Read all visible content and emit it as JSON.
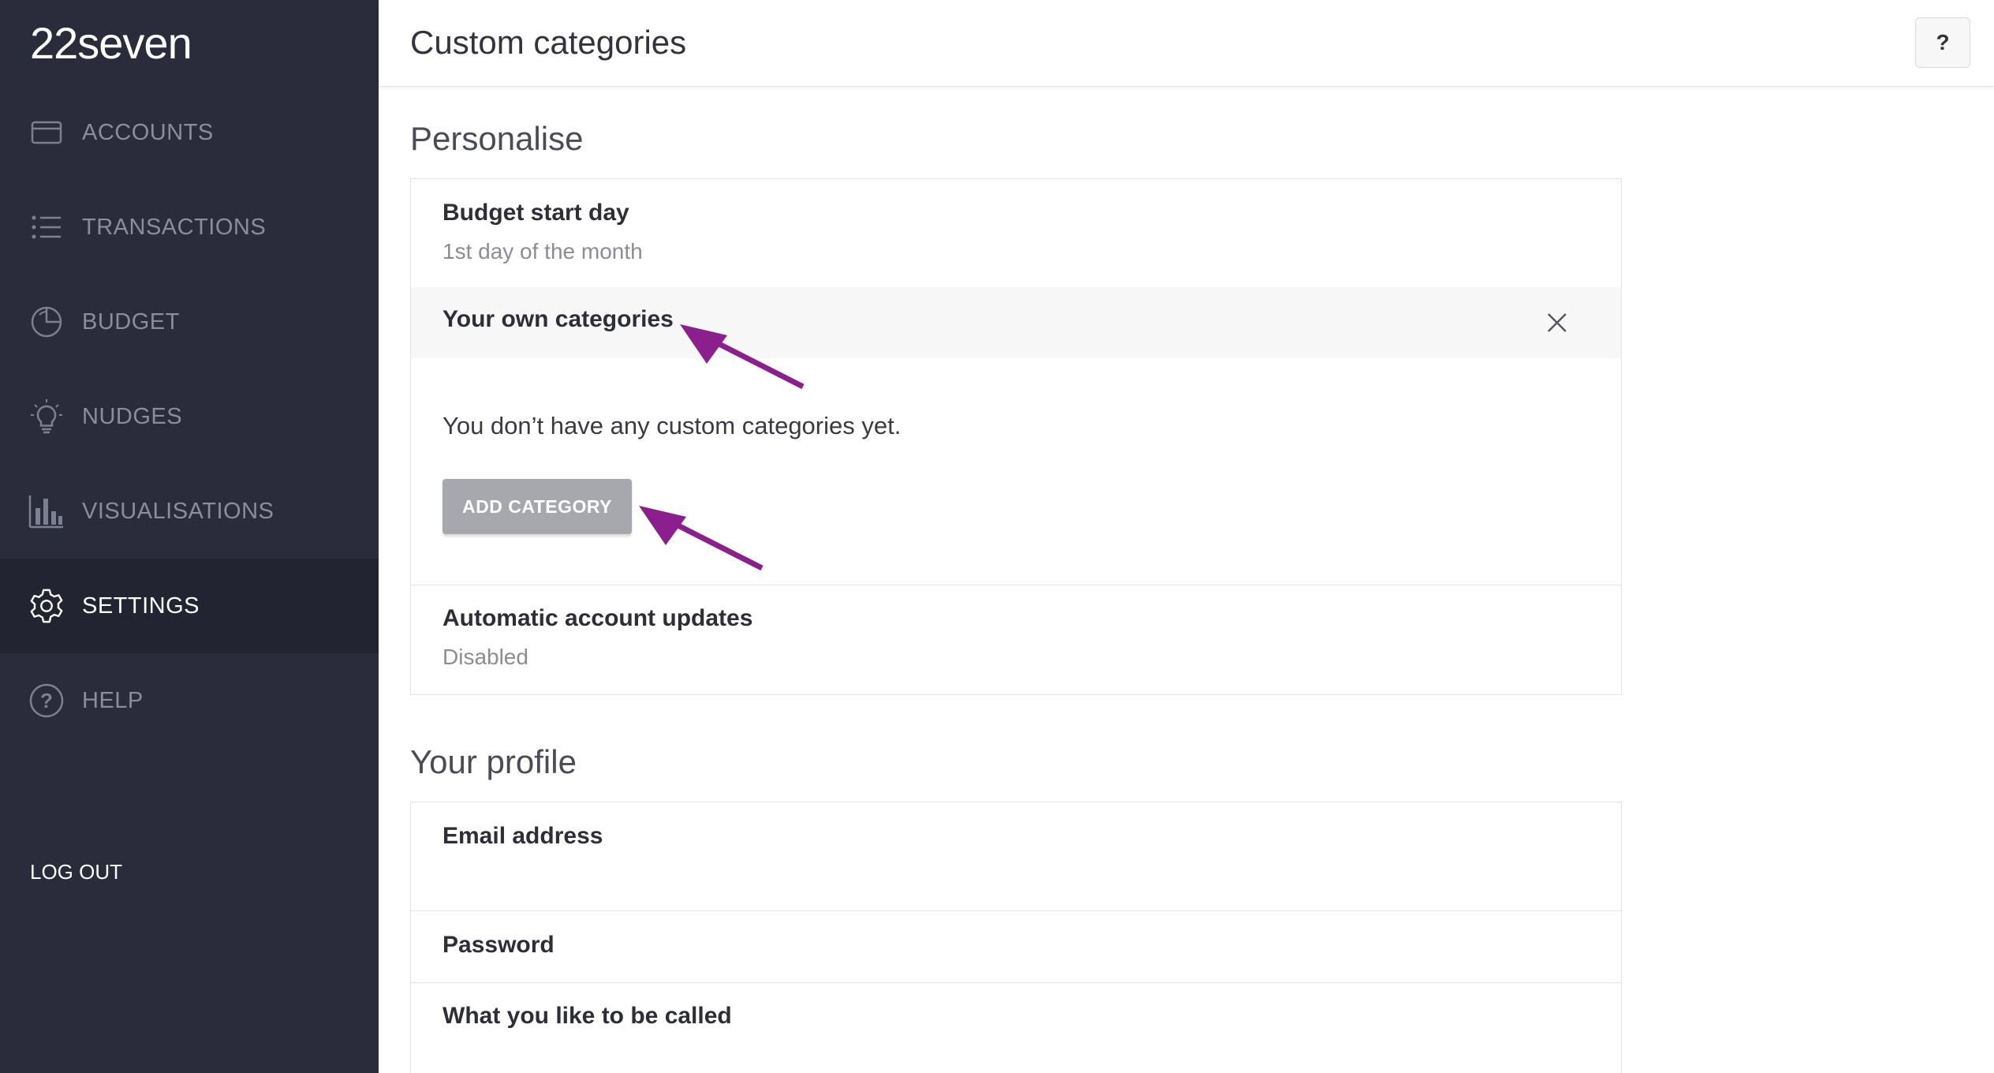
{
  "app": {
    "logo": "22seven"
  },
  "sidebar": {
    "items": [
      {
        "label": "ACCOUNTS",
        "icon": "card-icon"
      },
      {
        "label": "TRANSACTIONS",
        "icon": "list-icon"
      },
      {
        "label": "BUDGET",
        "icon": "pie-icon"
      },
      {
        "label": "NUDGES",
        "icon": "lightbulb-icon"
      },
      {
        "label": "VISUALISATIONS",
        "icon": "bar-chart-icon"
      },
      {
        "label": "SETTINGS",
        "icon": "gear-icon",
        "active": true
      },
      {
        "label": "HELP",
        "icon": "help-circle-icon"
      }
    ],
    "logout": "LOG OUT"
  },
  "header": {
    "title": "Custom categories",
    "help": "?"
  },
  "personalise": {
    "title": "Personalise",
    "budget_start": {
      "label": "Budget start day",
      "value": "1st day of the month"
    },
    "own_categories": {
      "label": "Your own categories",
      "empty_message": "You don’t have any custom categories yet.",
      "add_button": "ADD CATEGORY"
    },
    "auto_updates": {
      "label": "Automatic account updates",
      "value": "Disabled"
    }
  },
  "profile": {
    "title": "Your profile",
    "email_label": "Email address",
    "password_label": "Password",
    "name_label": "What you like to be called"
  },
  "colors": {
    "sidebar_bg": "#2a2c3b",
    "sidebar_active_bg": "#222431",
    "annotation_arrow": "#8b1f8e",
    "button_bg": "#a7a8ad"
  }
}
